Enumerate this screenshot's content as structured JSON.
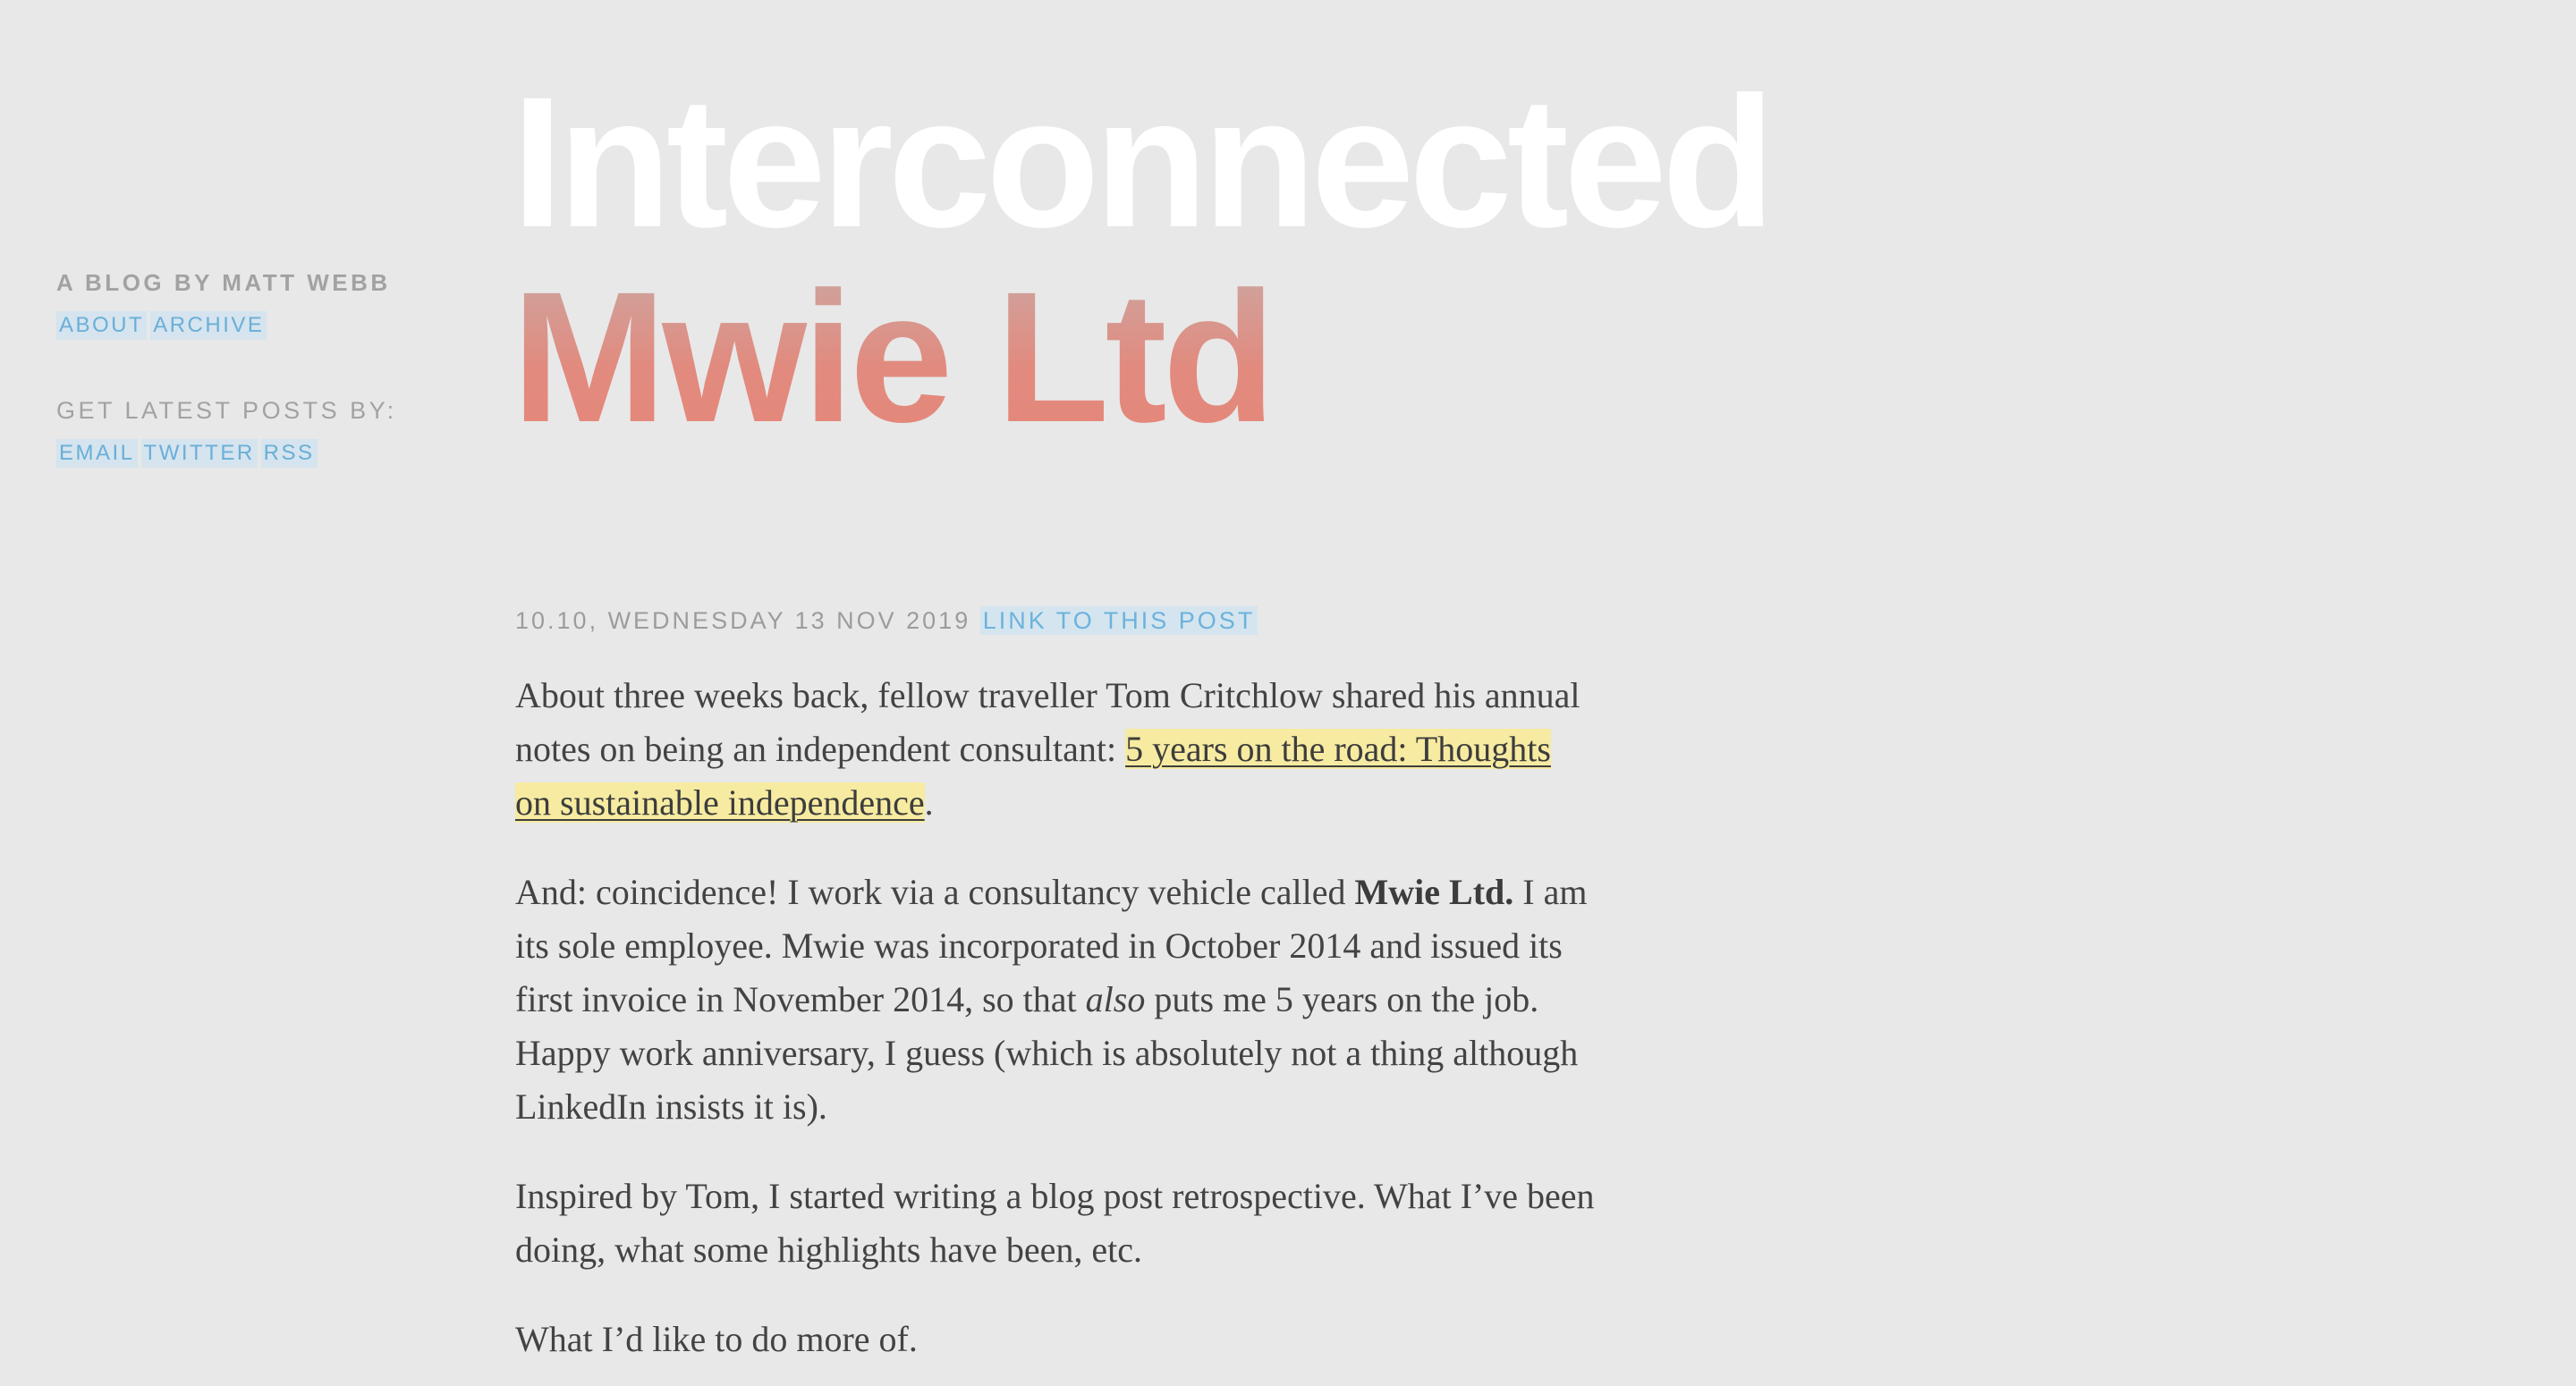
{
  "sidebar": {
    "byline": "A BLOG BY MATT WEBB",
    "nav": [
      {
        "label": "ABOUT"
      },
      {
        "label": "ARCHIVE"
      }
    ],
    "subscribe_heading": "GET LATEST POSTS BY:",
    "subscribe_links": [
      {
        "label": "EMAIL"
      },
      {
        "label": "TWITTER"
      },
      {
        "label": "RSS"
      }
    ]
  },
  "header": {
    "blog_title": "Interconnected",
    "post_title": "Mwie Ltd"
  },
  "post": {
    "meta": "10.10, WEDNESDAY 13 NOV 2019",
    "permalink_label": "LINK TO THIS POST",
    "paragraphs": {
      "p1": {
        "text_before": "About three weeks back, fellow traveller Tom Critchlow shared his annual notes on being an independent consultant: ",
        "link": "5 years on the road: Thoughts on sustainable independence",
        "text_after": "."
      },
      "p2": {
        "text_before": "And: coincidence! I work via a consultancy vehicle called ",
        "bold": "Mwie Ltd.",
        "text_middle": " I am its sole employee. Mwie was incorporated in October 2014 and issued its first invoice in November 2014, so that ",
        "italic": "also",
        "text_after": " puts me 5 years on the job. Happy work anniversary, I guess (which is absolutely not a thing although LinkedIn insists it is)."
      },
      "p3": "Inspired by Tom, I started writing a blog post retrospective. What I’ve been doing, what some highlights have been, etc.",
      "p4": "What I’d like to do more of."
    }
  },
  "colors": {
    "background": "#e8e8e8",
    "link_bg": "#d5e4ee",
    "link_text": "#6aaed8",
    "highlight_bg": "#f6eba1",
    "title_gradient_top": "#c9aaa6",
    "title_gradient_bottom": "#e5877a"
  }
}
